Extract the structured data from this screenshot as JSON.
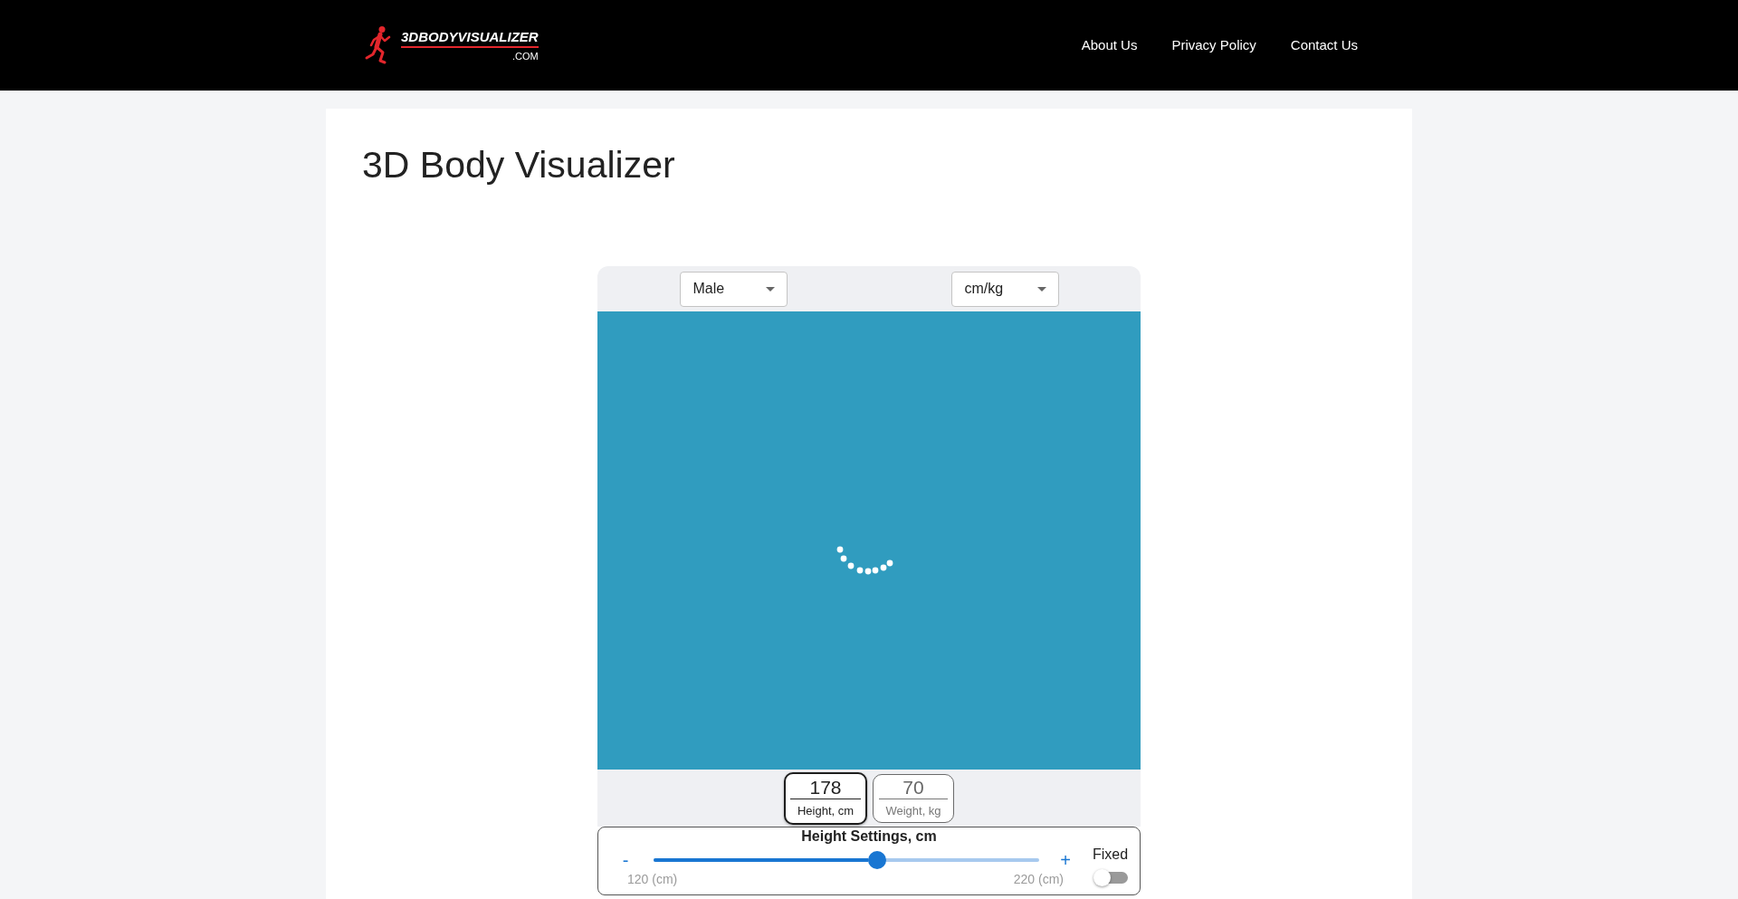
{
  "header": {
    "logo": {
      "name": "3DBODYVISUALIZER",
      "suffix": ".COM"
    },
    "nav": [
      "About Us",
      "Privacy Policy",
      "Contact Us"
    ]
  },
  "page": {
    "title": "3D Body Visualizer"
  },
  "visualizer": {
    "selects": [
      {
        "value": "Male"
      },
      {
        "value": "cm/kg"
      }
    ],
    "viewer": {
      "loading": true
    },
    "measurements": [
      {
        "value": "178",
        "label": "Height, cm",
        "selected": true
      },
      {
        "value": "70",
        "label": "Weight, kg",
        "selected": false
      }
    ],
    "settings": {
      "title": "Height Settings, cm",
      "decrease": "-",
      "increase": "+",
      "level": 0.58,
      "min_label": "120 (cm)",
      "max_label": "220 (cm)",
      "fixed": {
        "label": "Fixed",
        "on": false
      }
    }
  }
}
